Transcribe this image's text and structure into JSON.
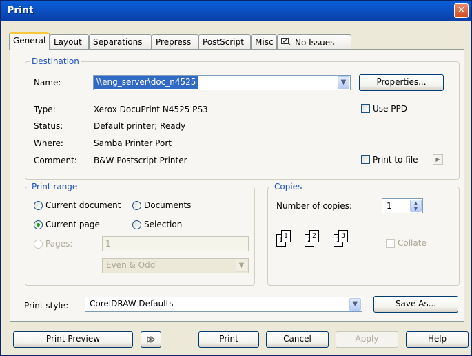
{
  "window": {
    "title": "Print",
    "close_glyph": "✕"
  },
  "tabs": [
    {
      "label": "General"
    },
    {
      "label": "Layout"
    },
    {
      "label": "Separations"
    },
    {
      "label": "Prepress"
    },
    {
      "label": "PostScript"
    },
    {
      "label": "Misc"
    },
    {
      "label": "No Issues",
      "icon": "checklist-icon"
    }
  ],
  "destination": {
    "title": "Destination",
    "name_label": "Name:",
    "name_value": "\\\\eng_server\\doc_n4525",
    "properties_button": "Properties...",
    "type_label": "Type:",
    "type_value": "Xerox DocuPrint N4525 PS3",
    "status_label": "Status:",
    "status_value": "Default printer; Ready",
    "where_label": "Where:",
    "where_value": "Samba Printer Port",
    "comment_label": "Comment:",
    "comment_value": "B&W Postscript Printer",
    "use_ppd_label": "Use PPD",
    "print_to_file_label": "Print to file"
  },
  "print_range": {
    "title": "Print range",
    "current_document": "Current document",
    "documents": "Documents",
    "current_page": "Current page",
    "selection": "Selection",
    "pages_label": "Pages:",
    "pages_value": "1",
    "even_odd": "Even & Odd",
    "selected": "current_page"
  },
  "copies": {
    "title": "Copies",
    "number_label": "Number of copies:",
    "number_value": "1",
    "collate_label": "Collate",
    "page_labels": [
      "1",
      "1",
      "2",
      "2",
      "3",
      "3"
    ]
  },
  "print_style": {
    "label": "Print style:",
    "value": "CorelDRAW Defaults",
    "save_as_button": "Save As..."
  },
  "footer": {
    "print_preview": "Print Preview",
    "print": "Print",
    "cancel": "Cancel",
    "apply": "Apply",
    "help": "Help"
  }
}
